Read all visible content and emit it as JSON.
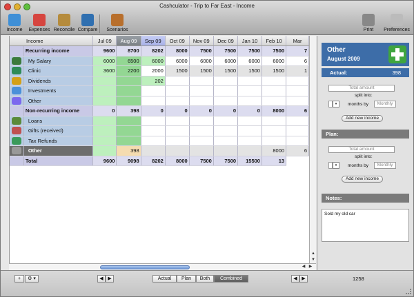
{
  "window": {
    "title": "Cashculator - Trip to Far East - Income"
  },
  "toolbar": {
    "left": [
      {
        "label": "Income",
        "icon": "income-icon",
        "color": "#3f8fd6"
      },
      {
        "label": "Expenses",
        "icon": "expenses-icon",
        "color": "#d6453f"
      },
      {
        "label": "Reconcile",
        "icon": "scales-icon",
        "color": "#b58b3c"
      },
      {
        "label": "Compare",
        "icon": "chart-icon",
        "color": "#2f6fb0"
      },
      {
        "label": "Scenarios",
        "icon": "money-bag-icon",
        "color": "#b86f2c"
      }
    ],
    "right": [
      {
        "label": "Print",
        "icon": "printer-icon",
        "color": "#888888"
      },
      {
        "label": "Preferences",
        "icon": "switch-icon",
        "color": "#bbbbbb"
      }
    ]
  },
  "grid": {
    "header_label": "Income",
    "months": [
      "Jul 09",
      "Aug 09",
      "Sep 09",
      "Oct 09",
      "Nov 09",
      "Dec 09",
      "Jan 10",
      "Feb 10",
      "Mar"
    ],
    "rows": [
      {
        "name": "Recurring income",
        "icon": "",
        "type": "sum",
        "values": [
          "9600",
          "8700",
          "8202",
          "8000",
          "7500",
          "7500",
          "7500",
          "7500",
          "7"
        ]
      },
      {
        "name": "My Salary",
        "icon": "salary-icon",
        "type": "item",
        "values": [
          "6000",
          "6500",
          "6000",
          "6000",
          "6000",
          "6000",
          "6000",
          "6000",
          "6"
        ]
      },
      {
        "name": "Clinic",
        "icon": "clinic-icon",
        "type": "item",
        "values": [
          "3600",
          "2200",
          "2000",
          "1500",
          "1500",
          "1500",
          "1500",
          "1500",
          "1"
        ]
      },
      {
        "name": "Dividends",
        "icon": "dividends-icon",
        "type": "item",
        "values": [
          "",
          "",
          "202",
          "",
          "",
          "",
          "",
          "",
          ""
        ]
      },
      {
        "name": "Investments",
        "icon": "investments-icon",
        "type": "item",
        "values": [
          "",
          "",
          "",
          "",
          "",
          "",
          "",
          "",
          ""
        ]
      },
      {
        "name": "Other",
        "icon": "other-icon",
        "type": "item",
        "values": [
          "",
          "",
          "",
          "",
          "",
          "",
          "",
          "",
          ""
        ]
      },
      {
        "name": "Non-recurring income",
        "icon": "",
        "type": "sum",
        "values": [
          "0",
          "398",
          "0",
          "0",
          "0",
          "0",
          "0",
          "8000",
          "6"
        ]
      },
      {
        "name": "Loans",
        "icon": "loans-icon",
        "type": "item",
        "values": [
          "",
          "",
          "",
          "",
          "",
          "",
          "",
          "",
          ""
        ]
      },
      {
        "name": "Gifts (received)",
        "icon": "gifts-icon",
        "type": "item",
        "values": [
          "",
          "",
          "",
          "",
          "",
          "",
          "",
          "",
          ""
        ]
      },
      {
        "name": "Tax Refunds",
        "icon": "tax-refunds-icon",
        "type": "item",
        "values": [
          "",
          "",
          "",
          "",
          "",
          "",
          "",
          "",
          ""
        ]
      },
      {
        "name": "Other",
        "icon": "other-selected-icon",
        "type": "selected",
        "values": [
          "",
          "398",
          "",
          "",
          "",
          "",
          "",
          "8000",
          "6"
        ]
      },
      {
        "name": "Total",
        "icon": "",
        "type": "sum",
        "values": [
          "9600",
          "9098",
          "8202",
          "8000",
          "7500",
          "7500",
          "15500",
          "13"
        ]
      }
    ]
  },
  "panel": {
    "title": "Other",
    "subtitle": "August 2009",
    "actual_label": "Actual:",
    "actual_value": "398",
    "actual_section": {
      "total_placeholder": "Total amount",
      "split_label": "split into:",
      "months_by_label": "months by",
      "months_by_value": "Monthly",
      "add_button": "Add new income"
    },
    "plan_label": "Plan:",
    "plan_section": {
      "total_placeholder": "Total amount",
      "split_label": "split into:",
      "months_by_label": "months by",
      "months_by_value": "Monthly",
      "add_button": "Add new income"
    },
    "notes_label": "Notes:",
    "notes_value": "Sold my old car"
  },
  "bottom": {
    "add_label": "+",
    "gear_label": "⚙ ▾",
    "prev_label": "◀",
    "next_label": "▶",
    "views": [
      "Actual",
      "Plan",
      "Both",
      "Combined"
    ],
    "active_view": "Combined",
    "number": "1258"
  },
  "colors": {
    "accent_blue": "#3d6da8",
    "green_cell": "#bdf0bd",
    "dark_green_cell": "#93d793",
    "sum_row": "#dcdcef"
  }
}
